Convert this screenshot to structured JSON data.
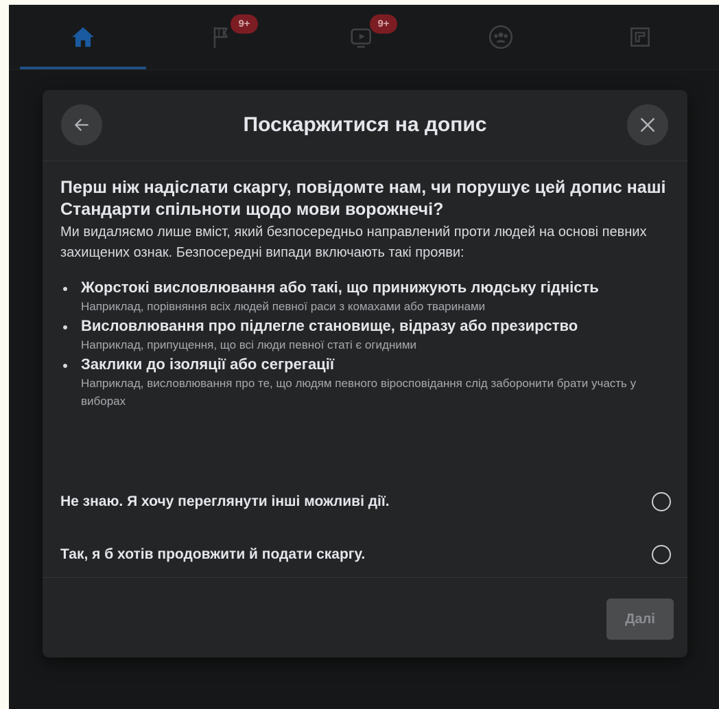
{
  "topnav": {
    "tabs": [
      {
        "name": "home",
        "icon": "home-icon",
        "active": true,
        "badge": ""
      },
      {
        "name": "pages",
        "icon": "flag-icon",
        "active": false,
        "badge": "9+"
      },
      {
        "name": "watch",
        "icon": "video-icon",
        "active": false,
        "badge": "9+"
      },
      {
        "name": "groups",
        "icon": "groups-icon",
        "active": false,
        "badge": ""
      },
      {
        "name": "gaming",
        "icon": "gaming-icon",
        "active": false,
        "badge": ""
      }
    ]
  },
  "dialog": {
    "title": "Поскаржитися на допис",
    "back_icon": "arrow-left-icon",
    "close_icon": "close-icon",
    "heading": "Перш ніж надіслати скаргу, повідомте нам, чи порушує цей допис наші Стандарти спільноти щодо мови ворожнечі?",
    "intro": "Ми видаляємо лише вміст, який безпосередньо направлений проти людей на основі певних захищених ознак. Безпосередні випади включають такі прояви:",
    "bullets": [
      {
        "title": "Жорстокі висловлювання або такі, що принижують людську гідність",
        "example": "Наприклад, порівняння всіх людей певної раси з комахами або тваринами"
      },
      {
        "title": "Висловлювання про підлегле становище, відразу або презирство",
        "example": "Наприклад, припущення, що всі люди певної статі є огидними"
      },
      {
        "title": "Заклики до ізоляції або сегрегації",
        "example": "Наприклад, висловлювання про те, що людям певного віросповідання слід заборонити брати участь у виборах"
      }
    ],
    "options": [
      {
        "label": "Не знаю. Я хочу переглянути інші можливі дії.",
        "selected": false
      },
      {
        "label": "Так, я б хотів продовжити й подати скаргу.",
        "selected": false
      }
    ],
    "next_label": "Далі"
  },
  "colors": {
    "page_bg": "#fdfcf3",
    "app_bg": "#161718",
    "dialog_bg": "#242526",
    "accent": "#1f4f84",
    "badge": "#7c1d23",
    "text": "#e4e6eb",
    "muted": "#a7aaaf"
  }
}
